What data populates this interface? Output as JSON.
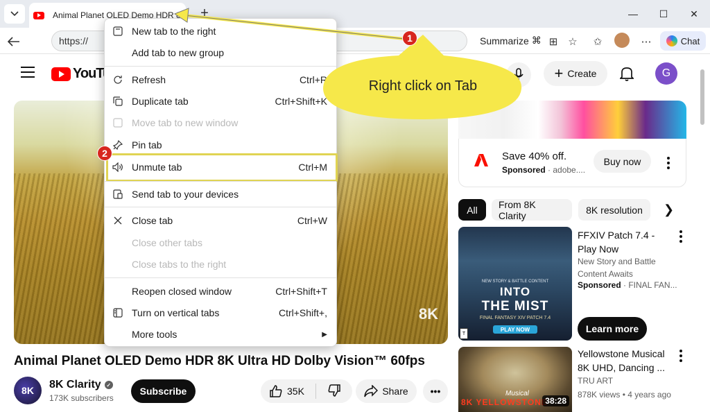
{
  "browser": {
    "tab_title": "Animal Planet OLED Demo HDR 8K",
    "url": "https://",
    "summarize_label": "Summarize",
    "chat_label": "Chat"
  },
  "youtube": {
    "logo_text": "YouTube",
    "create_label": "Create",
    "avatar_initial": "G",
    "video_title": "Animal Planet OLED Demo HDR 8K Ultra HD Dolby Vision™ 60fps",
    "video_watermark": "8K",
    "channel_name": "8K Clarity",
    "channel_avatar_text": "8K",
    "subscribers": "173K subscribers",
    "subscribe_label": "Subscribe",
    "likes": "35K",
    "share_label": "Share"
  },
  "ad": {
    "title": "Save 40% off.",
    "sponsored": "Sponsored",
    "source": "adobe....",
    "cta": "Buy now"
  },
  "chips": [
    "All",
    "From 8K Clarity",
    "8K resolution"
  ],
  "recommendations": [
    {
      "title": "FFXIV Patch 7.4 - Play Now",
      "description": "New Story and Battle Content Awaits",
      "sponsored": "Sponsored",
      "source": "FINAL FAN...",
      "cta": "Learn more",
      "thumb_small": "NEW STORY & BATTLE CONTENT",
      "thumb_line1": "INTO",
      "thumb_line2": "THE MIST",
      "thumb_line3": "FINAL FANTASY XIV PATCH 7.4",
      "thumb_button": "PLAY NOW",
      "rating": "T"
    },
    {
      "title": "Yellowstone Musical 8K UHD, Dancing ...",
      "channel": "TRU ART",
      "meta": "878K views • 4 years ago",
      "duration": "38:28",
      "thumb_script": "Musical",
      "thumb_text": "8K YELLOWSTONE"
    }
  ],
  "context_menu": {
    "items": [
      {
        "label": "New tab to the right",
        "shortcut": "",
        "icon": "new-tab-icon",
        "disabled": false
      },
      {
        "label": "Add tab to new group",
        "shortcut": "",
        "icon": "",
        "disabled": false
      },
      {
        "label": "Refresh",
        "shortcut": "Ctrl+R",
        "icon": "refresh-icon",
        "disabled": false
      },
      {
        "label": "Duplicate tab",
        "shortcut": "Ctrl+Shift+K",
        "icon": "duplicate-icon",
        "disabled": false
      },
      {
        "label": "Move tab to new window",
        "shortcut": "",
        "icon": "window-icon",
        "disabled": true
      },
      {
        "label": "Pin tab",
        "shortcut": "",
        "icon": "pin-icon",
        "disabled": false
      },
      {
        "label": "Unmute tab",
        "shortcut": "Ctrl+M",
        "icon": "speaker-icon",
        "disabled": false
      },
      {
        "label": "Send tab to your devices",
        "shortcut": "",
        "icon": "devices-icon",
        "disabled": false
      },
      {
        "label": "Close tab",
        "shortcut": "Ctrl+W",
        "icon": "close-icon",
        "disabled": false
      },
      {
        "label": "Close other tabs",
        "shortcut": "",
        "icon": "",
        "disabled": true
      },
      {
        "label": "Close tabs to the right",
        "shortcut": "",
        "icon": "",
        "disabled": true
      },
      {
        "label": "Reopen closed window",
        "shortcut": "Ctrl+Shift+T",
        "icon": "",
        "disabled": false
      },
      {
        "label": "Turn on vertical tabs",
        "shortcut": "Ctrl+Shift+,",
        "icon": "vertical-tabs-icon",
        "disabled": false
      },
      {
        "label": "More tools",
        "shortcut": "",
        "icon": "",
        "disabled": false
      }
    ]
  },
  "annotations": {
    "badge1": "1",
    "badge2": "2",
    "callout": "Right click on Tab",
    "callout_color": "#f6e84a",
    "badge_color": "#d7261e"
  }
}
